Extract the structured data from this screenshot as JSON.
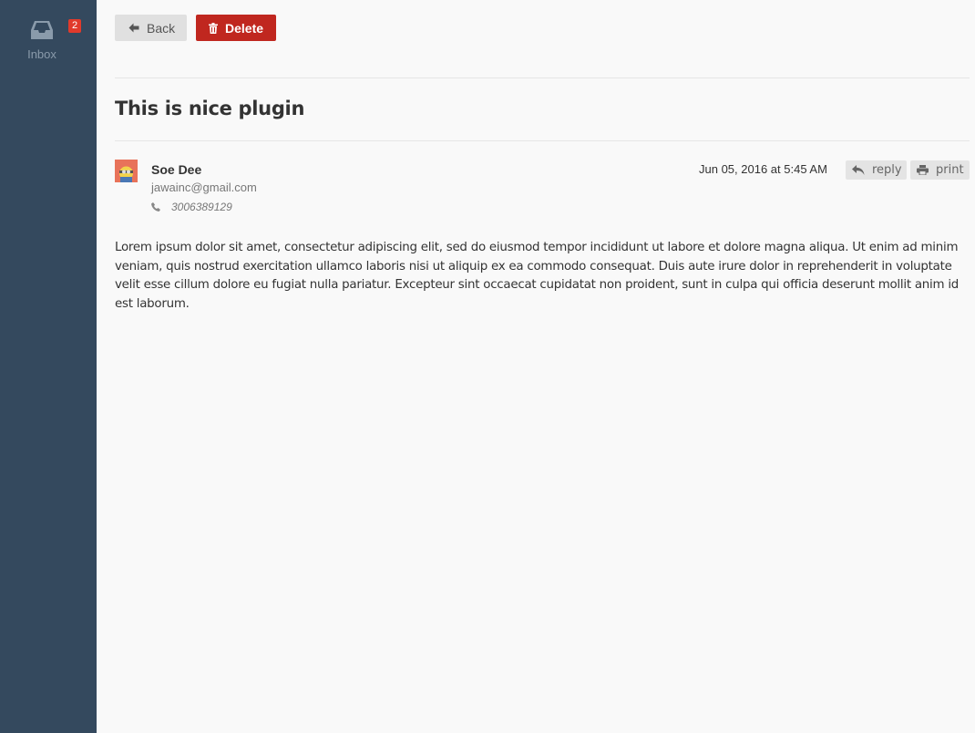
{
  "sidebar": {
    "inbox": {
      "icon": "inbox-tray-icon",
      "label": "Inbox",
      "badge": "2"
    }
  },
  "toolbar": {
    "back_label": "Back",
    "back_icon": "arrow-left-icon",
    "delete_label": "Delete",
    "delete_icon": "trash-icon"
  },
  "message": {
    "subject": "This is nice plugin",
    "sender": {
      "name": "Soe Dee",
      "email": "jawainc@gmail.com",
      "phone": "3006389129",
      "avatar_icon": "avatar-icon"
    },
    "date": "Jun 05, 2016 at 5:45 AM",
    "actions": {
      "reply_label": "reply",
      "reply_icon": "reply-arrow-icon",
      "print_label": "print",
      "print_icon": "printer-icon"
    },
    "body": "Lorem ipsum dolor sit amet, consectetur adipiscing elit, sed do eiusmod tempor incididunt ut labore et dolore magna aliqua. Ut enim ad minim veniam, quis nostrud exercitation ullamco laboris nisi ut aliquip ex ea commodo consequat. Duis aute irure dolor in reprehenderit in voluptate velit esse cillum dolore eu fugiat nulla pariatur. Excepteur sint occaecat cupidatat non proident, sunt in culpa qui officia deserunt mollit anim id est laborum."
  },
  "colors": {
    "sidebar_bg": "#34495e",
    "badge_bg": "#e13a2b",
    "delete_bg": "#c0271f",
    "page_bg": "#f9f9f9"
  }
}
